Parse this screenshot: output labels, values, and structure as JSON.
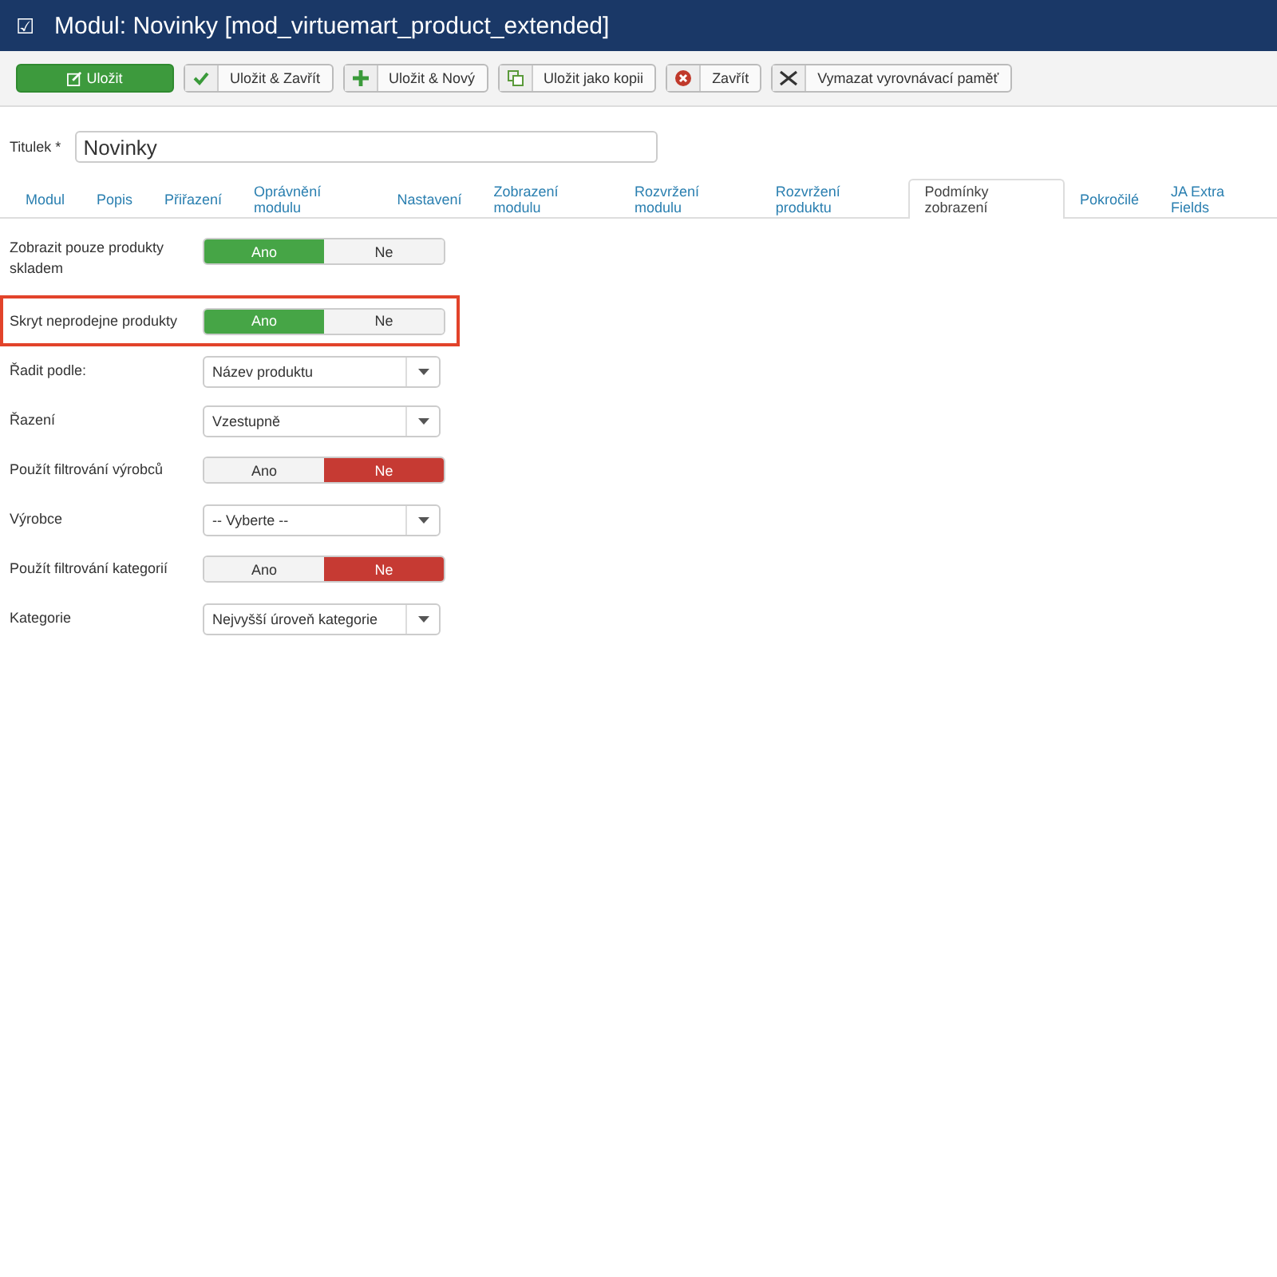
{
  "header": {
    "icon": "☑",
    "title": "Modul: Novinky [mod_virtuemart_product_extended]"
  },
  "toolbar": [
    {
      "kind": "save",
      "label": "Uložit",
      "primary": true
    },
    {
      "kind": "check",
      "label": "Uložit & Zavřít",
      "primary": false
    },
    {
      "kind": "plus",
      "label": "Uložit & Nový",
      "primary": false
    },
    {
      "kind": "copy",
      "label": "Uložit jako kopii",
      "primary": false
    },
    {
      "kind": "close",
      "label": "Zavřít",
      "primary": false
    },
    {
      "kind": "clear",
      "label": "Vymazat vyrovnávací paměť",
      "primary": false
    }
  ],
  "title_field": {
    "label": "Titulek *",
    "value": "Novinky"
  },
  "tabs": [
    {
      "label": "Modul",
      "selected": false
    },
    {
      "label": "Popis",
      "selected": false
    },
    {
      "label": "Přiřazení",
      "selected": false
    },
    {
      "label": "Oprávnění modulu",
      "selected": false
    },
    {
      "label": "Nastavení",
      "selected": false
    },
    {
      "label": "Zobrazení modulu",
      "selected": false
    },
    {
      "label": "Rozvržení modulu",
      "selected": false
    },
    {
      "label": "Rozvržení produktu",
      "selected": false
    },
    {
      "label": "Podmínky zobrazení",
      "selected": true
    },
    {
      "label": "Pokročilé",
      "selected": false
    },
    {
      "label": "JA Extra Fields",
      "selected": false
    }
  ],
  "fields": [
    {
      "kind": "toggle",
      "label": "Zobrazit pouze produkty skladem",
      "highlighted": false,
      "options": [
        {
          "label": "Ano",
          "selected": true
        },
        {
          "label": "Ne",
          "selected": false
        }
      ]
    },
    {
      "kind": "toggle",
      "label": "Skryt neprodejne produkty",
      "highlighted": true,
      "options": [
        {
          "label": "Ano",
          "selected": true
        },
        {
          "label": "Ne",
          "selected": false
        }
      ]
    },
    {
      "kind": "select",
      "label": "Řadit podle:",
      "highlighted": false,
      "value": "Název produktu"
    },
    {
      "kind": "select",
      "label": "Řazení",
      "highlighted": false,
      "value": "Vzestupně"
    },
    {
      "kind": "toggle",
      "label": "Použít filtrování výrobců",
      "highlighted": false,
      "options": [
        {
          "label": "Ano",
          "selected": false
        },
        {
          "label": "Ne",
          "selected": true
        }
      ]
    },
    {
      "kind": "select",
      "label": "Výrobce",
      "highlighted": false,
      "value": "-- Vyberte --"
    },
    {
      "kind": "toggle",
      "label": "Použít filtrování kategorií",
      "highlighted": false,
      "options": [
        {
          "label": "Ano",
          "selected": false
        },
        {
          "label": "Ne",
          "selected": true
        }
      ]
    },
    {
      "kind": "select",
      "label": "Kategorie",
      "highlighted": false,
      "value": "Nejvyšší úroveň kategorie"
    }
  ]
}
